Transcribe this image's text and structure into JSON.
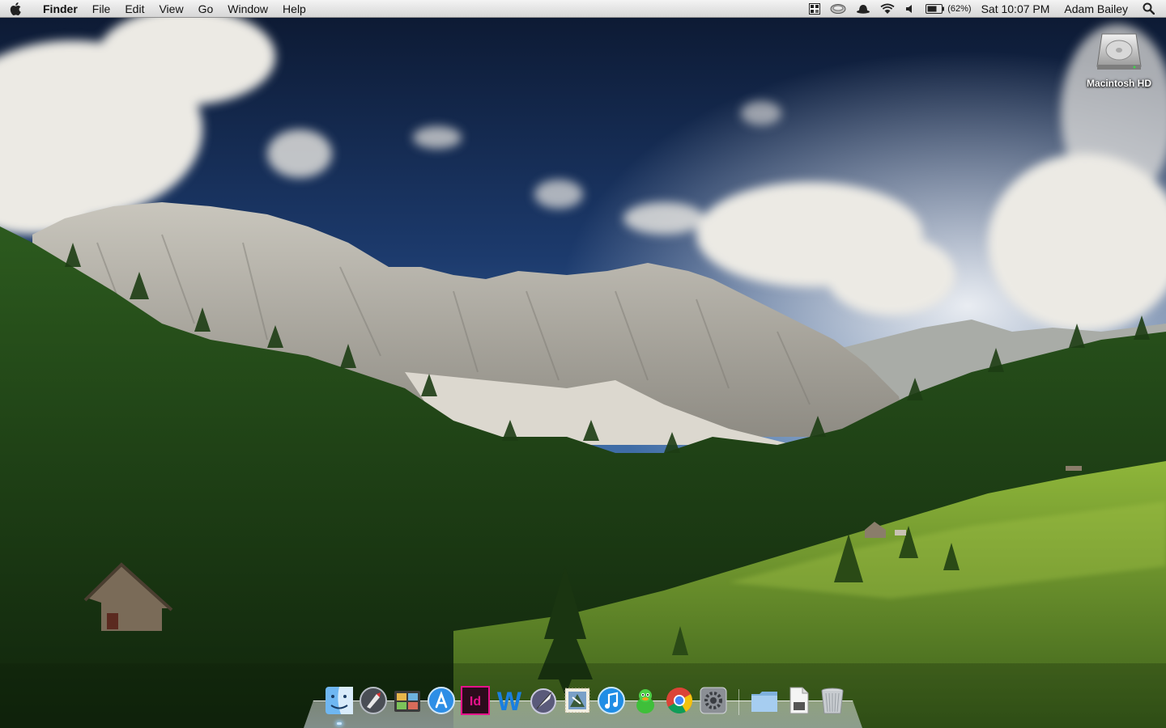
{
  "menubar": {
    "app_name": "Finder",
    "menus": [
      "File",
      "Edit",
      "View",
      "Go",
      "Window",
      "Help"
    ],
    "status": {
      "battery_percent": "(62%)",
      "clock": "Sat 10:07 PM",
      "user": "Adam Bailey"
    }
  },
  "desktop": {
    "icons": [
      {
        "label": "Macintosh HD"
      }
    ]
  },
  "dock": {
    "apps": [
      {
        "icon": "finder-icon"
      },
      {
        "icon": "launchpad-icon"
      },
      {
        "icon": "photo-browser-icon"
      },
      {
        "icon": "app-store-icon"
      },
      {
        "icon": "indesign-icon",
        "text": "Id"
      },
      {
        "icon": "word-icon",
        "text": "W"
      },
      {
        "icon": "quill-app-icon"
      },
      {
        "icon": "mail-stamp-icon"
      },
      {
        "icon": "itunes-icon"
      },
      {
        "icon": "adium-duck-icon"
      },
      {
        "icon": "chrome-icon"
      },
      {
        "icon": "system-preferences-icon"
      }
    ],
    "stacks": [
      {
        "icon": "folder-stack-icon"
      },
      {
        "icon": "document-stack-icon"
      },
      {
        "icon": "trash-icon"
      }
    ]
  },
  "colors": {
    "sky_top": "#0c1830",
    "sky_mid": "#2e5fa0",
    "rock": "#b9b6ad",
    "forest": "#2c5a1e",
    "meadow": "#6f9a2c",
    "indesign_pink": "#e6128b",
    "word_blue": "#1a7fe0"
  }
}
